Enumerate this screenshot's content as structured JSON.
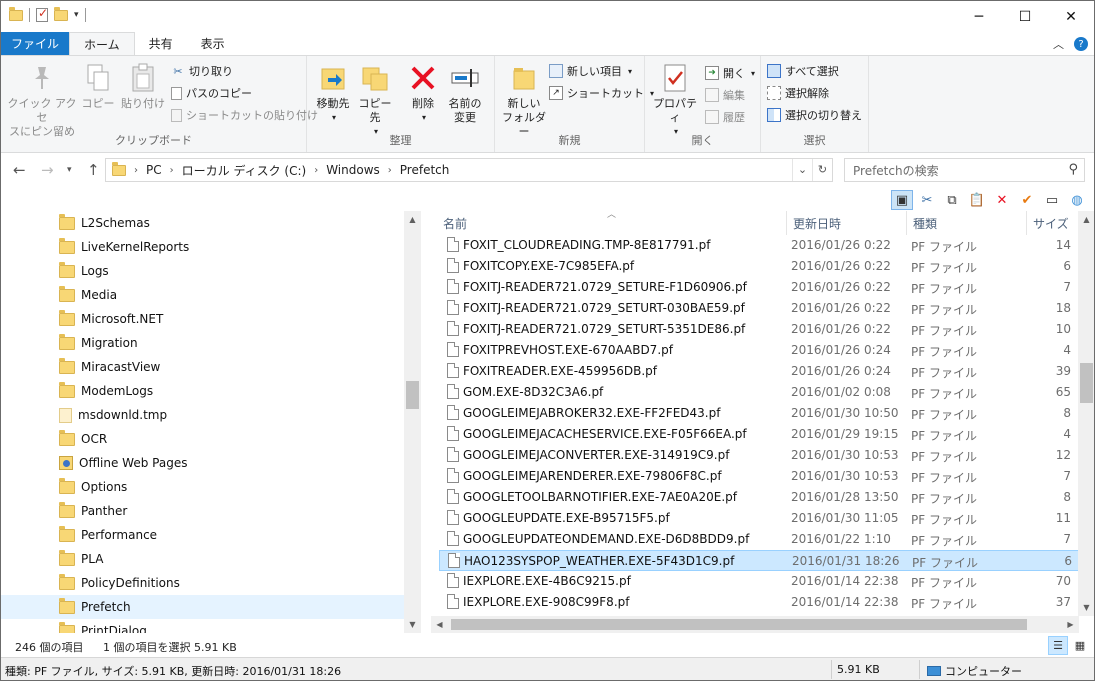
{
  "ribbon_tabs": {
    "file": "ファイル",
    "home": "ホーム",
    "share": "共有",
    "view": "表示"
  },
  "clipboard": {
    "label": "クリップボード",
    "pin_line1": "クイック アクセ",
    "pin_line2": "スにピン留め",
    "copy": "コピー",
    "paste": "貼り付け",
    "cut": "切り取り",
    "copy_path": "パスのコピー",
    "paste_shortcut": "ショートカットの貼り付け"
  },
  "organize": {
    "label": "整理",
    "move_to": "移動先",
    "copy_to": "コピー先",
    "delete": "削除",
    "rename_line1": "名前の",
    "rename_line2": "変更"
  },
  "new_group": {
    "label": "新規",
    "new_folder_line1": "新しい",
    "new_folder_line2": "フォルダー",
    "new_item": "新しい項目",
    "shortcut": "ショートカット"
  },
  "open_group": {
    "label": "開く",
    "properties": "プロパティ",
    "open": "開く",
    "edit": "編集",
    "history": "履歴"
  },
  "select_group": {
    "label": "選択",
    "select_all": "すべて選択",
    "select_none": "選択解除",
    "invert": "選択の切り替え"
  },
  "address": {
    "crumbs": [
      "PC",
      "ローカル ディスク (C:)",
      "Windows",
      "Prefetch"
    ]
  },
  "search": {
    "placeholder": "Prefetchの検索"
  },
  "nav_tree": [
    {
      "name": "L2Schemas",
      "type": "folder"
    },
    {
      "name": "LiveKernelReports",
      "type": "folder"
    },
    {
      "name": "Logs",
      "type": "folder"
    },
    {
      "name": "Media",
      "type": "folder"
    },
    {
      "name": "Microsoft.NET",
      "type": "folder"
    },
    {
      "name": "Migration",
      "type": "folder"
    },
    {
      "name": "MiracastView",
      "type": "folder"
    },
    {
      "name": "ModemLogs",
      "type": "folder"
    },
    {
      "name": "msdownld.tmp",
      "type": "tmp"
    },
    {
      "name": "OCR",
      "type": "folder"
    },
    {
      "name": "Offline Web Pages",
      "type": "web"
    },
    {
      "name": "Options",
      "type": "folder"
    },
    {
      "name": "Panther",
      "type": "folder"
    },
    {
      "name": "Performance",
      "type": "folder"
    },
    {
      "name": "PLA",
      "type": "folder"
    },
    {
      "name": "PolicyDefinitions",
      "type": "folder"
    },
    {
      "name": "Prefetch",
      "type": "folder",
      "selected": true
    },
    {
      "name": "PrintDialog",
      "type": "folder"
    }
  ],
  "columns": {
    "name": "名前",
    "modified": "更新日時",
    "type": "種類",
    "size": "サイズ"
  },
  "files": [
    {
      "name": "FOXIT_CLOUDREADING.TMP-8E817791.pf",
      "date": "2016/01/26 0:22",
      "type": "PF ファイル",
      "size": "14"
    },
    {
      "name": "FOXITCOPY.EXE-7C985EFA.pf",
      "date": "2016/01/26 0:22",
      "type": "PF ファイル",
      "size": "6"
    },
    {
      "name": "FOXITJ-READER721.0729_SETURE-F1D60906.pf",
      "date": "2016/01/26 0:22",
      "type": "PF ファイル",
      "size": "7"
    },
    {
      "name": "FOXITJ-READER721.0729_SETURT-030BAE59.pf",
      "date": "2016/01/26 0:22",
      "type": "PF ファイル",
      "size": "18"
    },
    {
      "name": "FOXITJ-READER721.0729_SETURT-5351DE86.pf",
      "date": "2016/01/26 0:22",
      "type": "PF ファイル",
      "size": "10"
    },
    {
      "name": "FOXITPREVHOST.EXE-670AABD7.pf",
      "date": "2016/01/26 0:24",
      "type": "PF ファイル",
      "size": "4"
    },
    {
      "name": "FOXITREADER.EXE-459956DB.pf",
      "date": "2016/01/26 0:24",
      "type": "PF ファイル",
      "size": "39"
    },
    {
      "name": "GOM.EXE-8D32C3A6.pf",
      "date": "2016/01/02 0:08",
      "type": "PF ファイル",
      "size": "65"
    },
    {
      "name": "GOOGLEIMEJABROKER32.EXE-FF2FED43.pf",
      "date": "2016/01/30 10:50",
      "type": "PF ファイル",
      "size": "8"
    },
    {
      "name": "GOOGLEIMEJACACHESERVICE.EXE-F05F66EA.pf",
      "date": "2016/01/29 19:15",
      "type": "PF ファイル",
      "size": "4"
    },
    {
      "name": "GOOGLEIMEJACONVERTER.EXE-314919C9.pf",
      "date": "2016/01/30 10:53",
      "type": "PF ファイル",
      "size": "12"
    },
    {
      "name": "GOOGLEIMEJARENDERER.EXE-79806F8C.pf",
      "date": "2016/01/30 10:53",
      "type": "PF ファイル",
      "size": "7"
    },
    {
      "name": "GOOGLETOOLBARNOTIFIER.EXE-7AE0A20E.pf",
      "date": "2016/01/28 13:50",
      "type": "PF ファイル",
      "size": "8"
    },
    {
      "name": "GOOGLEUPDATE.EXE-B95715F5.pf",
      "date": "2016/01/30 11:05",
      "type": "PF ファイル",
      "size": "11"
    },
    {
      "name": "GOOGLEUPDATEONDEMAND.EXE-D6D8BDD9.pf",
      "date": "2016/01/22 1:10",
      "type": "PF ファイル",
      "size": "7"
    },
    {
      "name": "HAO123SYSPOP_WEATHER.EXE-5F43D1C9.pf",
      "date": "2016/01/31 18:26",
      "type": "PF ファイル",
      "size": "6",
      "selected": true
    },
    {
      "name": "IEXPLORE.EXE-4B6C9215.pf",
      "date": "2016/01/14 22:38",
      "type": "PF ファイル",
      "size": "70"
    },
    {
      "name": "IEXPLORE.EXE-908C99F8.pf",
      "date": "2016/01/14 22:38",
      "type": "PF ファイル",
      "size": "37"
    }
  ],
  "status": {
    "item_count": "246 個の項目",
    "selected": "1 個の項目を選択 5.91 KB",
    "details": "種類: PF ファイル, サイズ: 5.91 KB, 更新日時: 2016/01/31 18:26",
    "size": "5.91 KB",
    "location": "コンピューター"
  },
  "icons": {
    "accent": "#1979ca",
    "delete": "#e81123",
    "selection_bg": "#cce8ff"
  }
}
